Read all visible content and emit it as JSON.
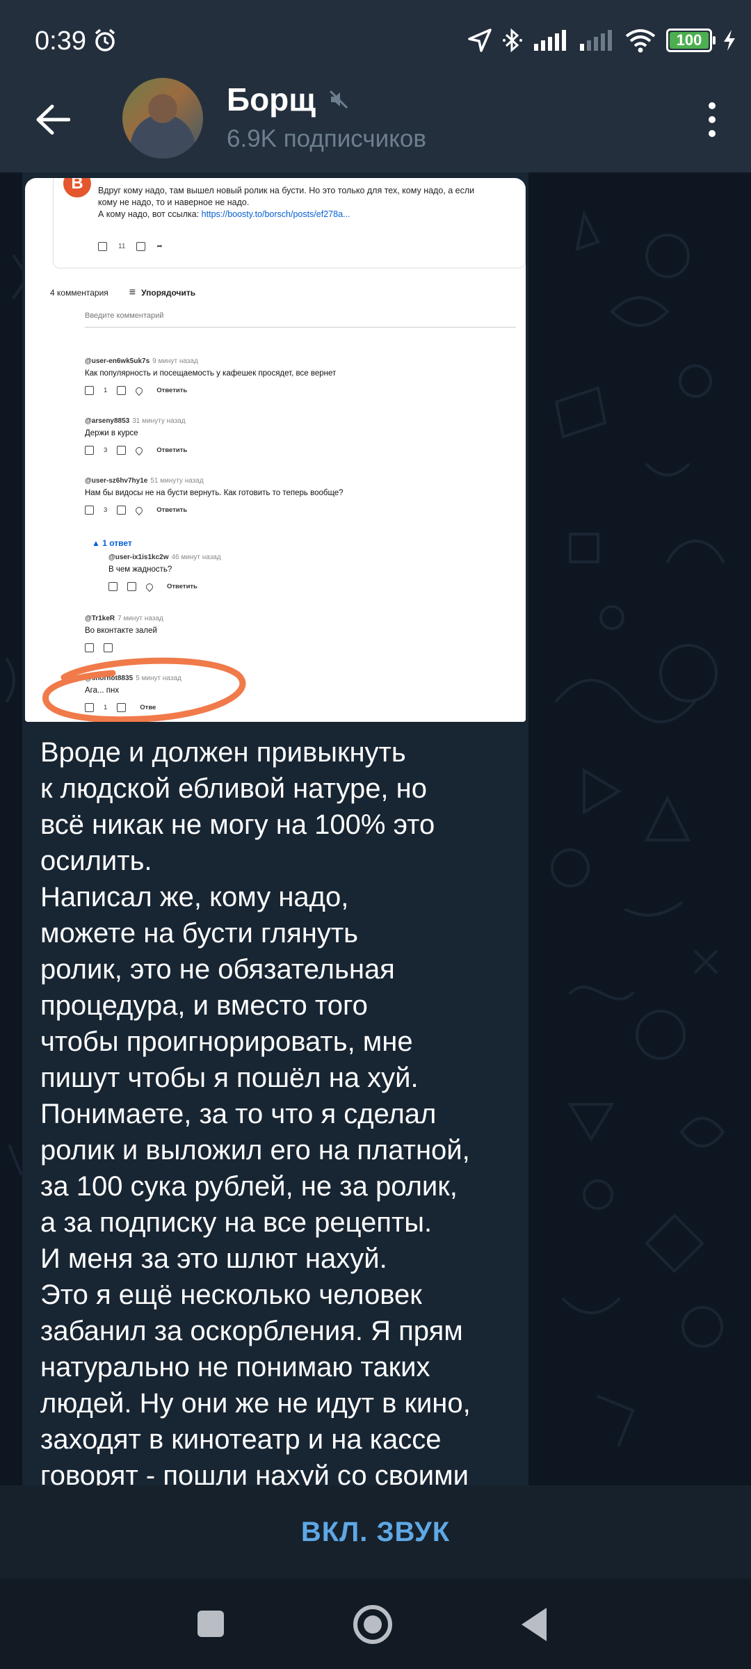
{
  "status_bar": {
    "time": "0:39",
    "battery": "100",
    "icons": [
      "alarm-icon",
      "location-icon",
      "bluetooth-icon",
      "signal-icon",
      "signal-weak-icon",
      "wifi-icon",
      "battery-icon",
      "charging-icon"
    ]
  },
  "header": {
    "title": "Борщ",
    "subtitle": "6.9K подписчиков",
    "muted": true
  },
  "screenshot": {
    "post_text": "Вдруг кому надо, там вышел новый ролик на бусти. Но это только для тех, кому надо, а если\nкому не надо, то и наверное не надо.\nА кому надо, вот ссылка: ",
    "post_link": "https://boosty.to/borsch/posts/ef278a...",
    "post_likes": "11",
    "comments_count": "4 комментария",
    "sort_label": "Упорядочить",
    "comment_placeholder": "Введите комментарий",
    "comments": [
      {
        "user": "@user-en6wk5uk7s",
        "time": "9 минут назад",
        "text": "Как популярность и посещаемость у кафешек просядет, все вернет",
        "likes": "1",
        "reply": "Ответить"
      },
      {
        "user": "@arseny8853",
        "time": "31 минуту назад",
        "text": "Держи в курсе",
        "likes": "3",
        "reply": "Ответить"
      },
      {
        "user": "@user-sz6hv7hy1e",
        "time": "51 минуту назад",
        "text": "Нам бы видосы не на бусти вернуть. Как готовить то теперь вообще?",
        "likes": "3",
        "reply": "Ответить"
      },
      {
        "user": "@user-ix1is1kc2w",
        "time": "46 минут назад",
        "text": "В чем жадность?",
        "likes": "",
        "reply": "Ответить"
      },
      {
        "user": "@Tr1keR",
        "time": "7 минут назад",
        "text": "Во вконтакте залей",
        "likes": "",
        "reply": ""
      },
      {
        "user": "@shorhot8835",
        "time": "5 минут назад",
        "text": "Ага... пнх",
        "likes": "1",
        "reply": "Отве"
      }
    ],
    "replies_toggle": "1 ответ"
  },
  "message": {
    "text": "Вроде и должен привыкнуть\nк людской ебливой натуре, но\nвсё никак не могу на 100% это\nосилить.\nНаписал же, кому надо,\nможете на бусти глянуть\nролик, это не обязательная\nпроцедура, и вместо того\nчтобы проигнорировать, мне\nпишут чтобы я пошёл на хуй.\nПонимаете, за то что я сделал\nролик и выложил его на платной,\nза 100 сука рублей, не за ролик,\nа за подписку на все рецепты.\nИ меня за это шлют нахуй.\nЭто я ещё несколько человек\nзабанил за оскорбления. Я прям\nнатурально не понимаю таких\nлюдей. Ну они же не идут в кино,\nзаходят в кинотеатр и на кассе\nговорят - пошли нахуй со своими"
  },
  "bottom_bar": {
    "unmute_label": "ВКЛ. ЗВУК"
  },
  "colors": {
    "header_bg": "#242f3d",
    "chat_bg": "#0e1621",
    "bubble_bg": "#182533",
    "accent": "#5ea8e6",
    "highlight_circle": "#f07a4a"
  }
}
